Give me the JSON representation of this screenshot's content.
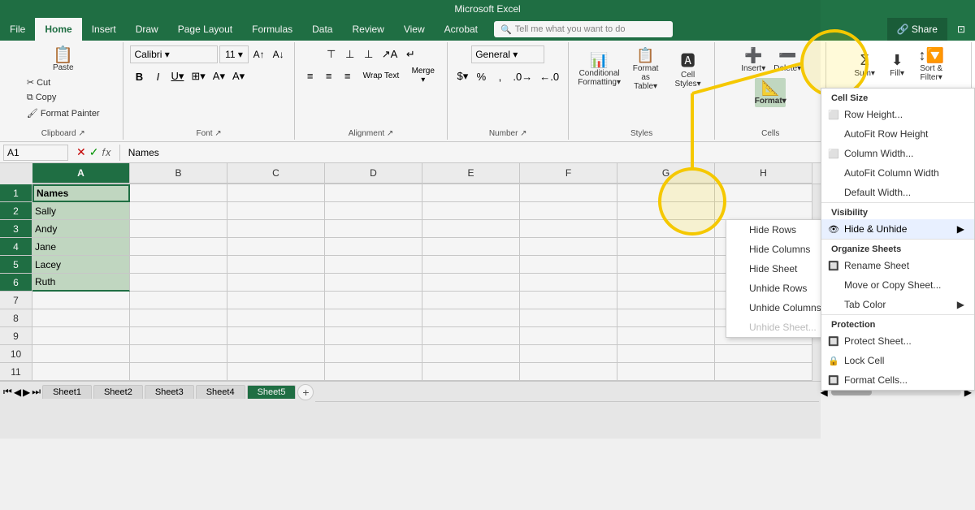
{
  "titleBar": {
    "text": "Microsoft Excel"
  },
  "ribbonTabs": [
    {
      "id": "file",
      "label": "File"
    },
    {
      "id": "home",
      "label": "Home",
      "active": true
    },
    {
      "id": "insert",
      "label": "Insert"
    },
    {
      "id": "draw",
      "label": "Draw"
    },
    {
      "id": "pageLayout",
      "label": "Page Layout"
    },
    {
      "id": "formulas",
      "label": "Formulas"
    },
    {
      "id": "data",
      "label": "Data"
    },
    {
      "id": "review",
      "label": "Review"
    },
    {
      "id": "view",
      "label": "View"
    },
    {
      "id": "acrobat",
      "label": "Acrobat"
    },
    {
      "id": "search",
      "placeholder": "Tell me what you want to do"
    },
    {
      "id": "share",
      "label": "Share"
    }
  ],
  "formulaBar": {
    "nameBox": "A1",
    "formula": "Names"
  },
  "columns": [
    "A",
    "B",
    "C",
    "D",
    "E",
    "F",
    "G",
    "H"
  ],
  "rows": [
    1,
    2,
    3,
    4,
    5,
    6,
    7,
    8,
    9,
    10,
    11
  ],
  "cellData": {
    "A1": "Names",
    "A2": "Sally",
    "A3": "Andy",
    "A4": "Jane",
    "A5": "Lacey",
    "A6": "Ruth"
  },
  "dropdownMenu": {
    "sections": [
      {
        "label": "Cell Size",
        "items": [
          {
            "id": "row-height",
            "label": "Row Height...",
            "icon": "⬜",
            "disabled": false
          },
          {
            "id": "autofit-row",
            "label": "AutoFit Row Height",
            "disabled": false
          },
          {
            "id": "col-width",
            "label": "Column Width...",
            "icon": "⬜",
            "disabled": false
          },
          {
            "id": "autofit-col",
            "label": "AutoFit Column Width",
            "disabled": false
          },
          {
            "id": "default-width",
            "label": "Default Width...",
            "disabled": false
          }
        ]
      },
      {
        "label": "Visibility",
        "items": [
          {
            "id": "hide-unhide",
            "label": "Hide & Unhide",
            "hasArrow": true,
            "disabled": false
          }
        ]
      },
      {
        "label": "Organize Sheets",
        "items": [
          {
            "id": "rename-sheet",
            "label": "Rename Sheet",
            "icon": "🔲",
            "disabled": false
          },
          {
            "id": "move-copy",
            "label": "Move or Copy Sheet...",
            "disabled": false
          },
          {
            "id": "tab-color",
            "label": "Tab Color",
            "hasArrow": true,
            "disabled": false
          }
        ]
      },
      {
        "label": "Protection",
        "items": [
          {
            "id": "protect-sheet",
            "label": "Protect Sheet...",
            "icon": "🔲",
            "disabled": false
          },
          {
            "id": "lock-cell",
            "label": "Lock Cell",
            "icon": "🔒",
            "disabled": false
          },
          {
            "id": "format-cells",
            "label": "Format Cells...",
            "icon": "🔲",
            "disabled": false
          }
        ]
      }
    ]
  },
  "smallDropdown": {
    "items": [
      {
        "label": "Hide Rows"
      },
      {
        "label": "Hide Columns"
      },
      {
        "label": "Hide Sheet"
      },
      {
        "label": "Unhide Rows"
      },
      {
        "label": "Unhide Columns"
      },
      {
        "label": "Unhide Sheet...",
        "disabled": true
      }
    ]
  },
  "sheetTabs": [
    "Sheet1",
    "Sheet2",
    "Sheet3",
    "Sheet4",
    "Sheet5"
  ],
  "activeSheet": "Sheet5",
  "formatButtonLabel": "Format",
  "colors": {
    "excel_green": "#217346",
    "highlight_yellow": "#f5c800",
    "selected_blue": "#c8dfc8"
  }
}
